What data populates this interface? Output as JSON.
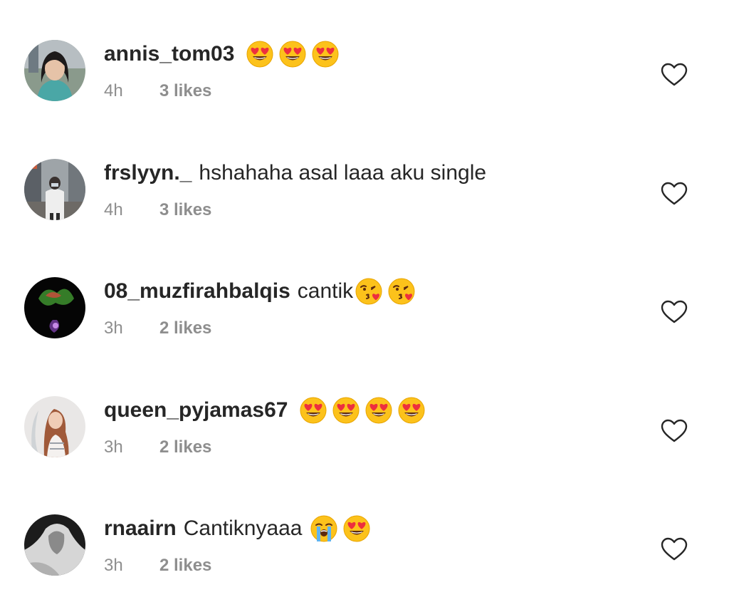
{
  "comments": [
    {
      "username": "annis_tom03",
      "text": "",
      "emojis": [
        "heart-eyes",
        "heart-eyes",
        "heart-eyes"
      ],
      "time": "4h",
      "likes": "3 likes"
    },
    {
      "username": "frslyyn._",
      "text": "hshahaha asal laaa aku single",
      "emojis": [],
      "time": "4h",
      "likes": "3 likes"
    },
    {
      "username": "08_muzfirahbalqis",
      "text": "cantik",
      "emojis": [
        "kissing-heart",
        "kissing-heart"
      ],
      "time": "3h",
      "likes": "2 likes"
    },
    {
      "username": "queen_pyjamas67",
      "text": "",
      "emojis": [
        "heart-eyes",
        "heart-eyes",
        "heart-eyes",
        "heart-eyes"
      ],
      "time": "3h",
      "likes": "2 likes"
    },
    {
      "username": "rnaairn",
      "text": "Cantiknyaaa",
      "emojis": [
        "loudly-crying",
        "heart-eyes"
      ],
      "time": "3h",
      "likes": "2 likes"
    }
  ],
  "colors": {
    "text": "#262626",
    "secondary": "#8e8e8e",
    "emoji_face": "#fcc21b",
    "emoji_heart": "#ed2f3e"
  },
  "icons": {
    "like": "heart-outline-icon"
  }
}
